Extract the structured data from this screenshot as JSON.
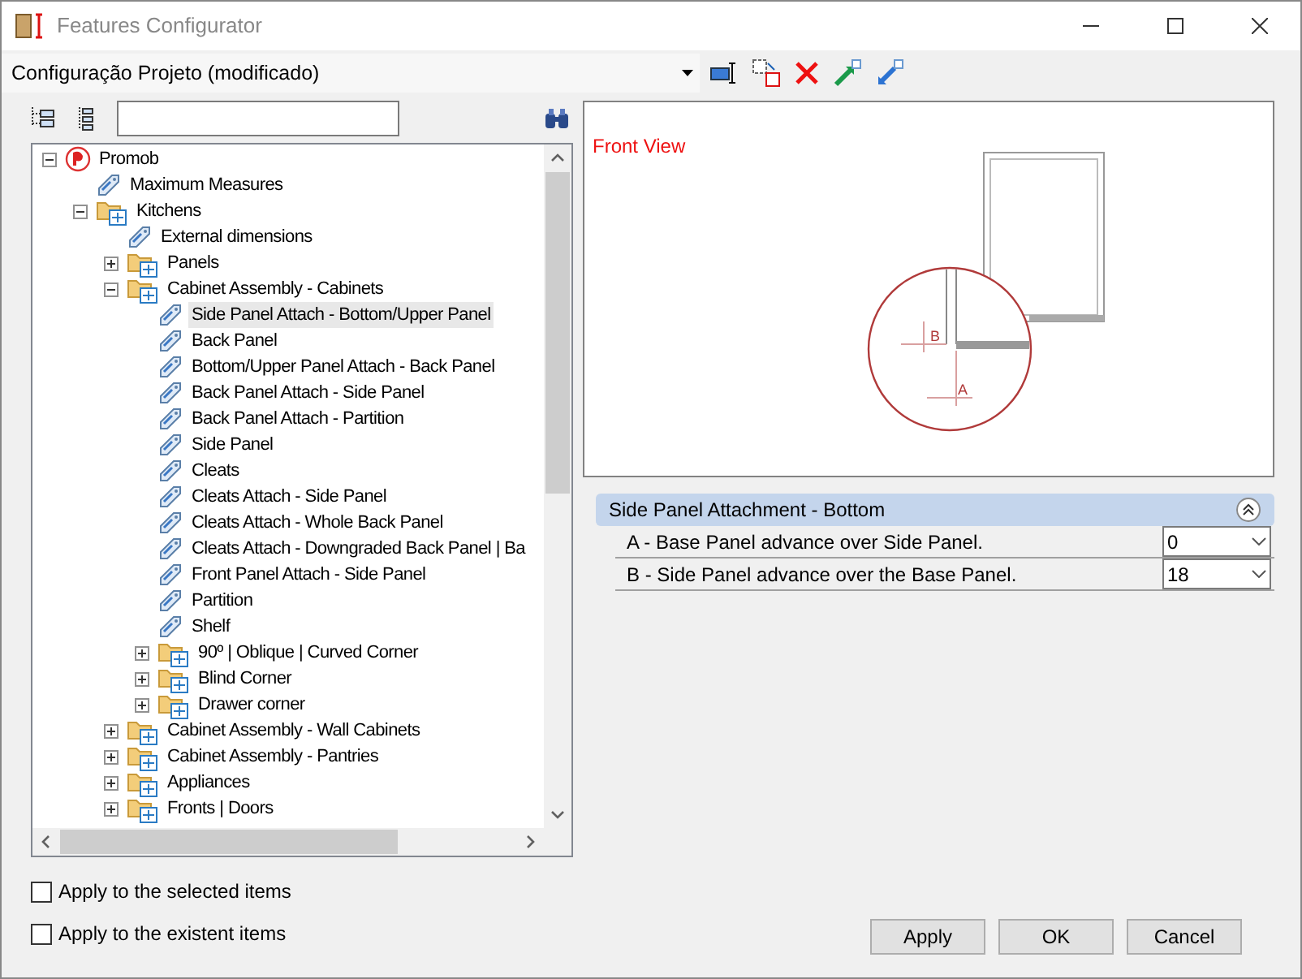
{
  "window": {
    "title": "Features Configurator"
  },
  "configuration": {
    "value": "Configuração Projeto (modificado)"
  },
  "tree": [
    {
      "label": "Promob",
      "kind": "root",
      "expanded": true,
      "selected": false,
      "children": [
        {
          "label": "Maximum Measures",
          "kind": "feature",
          "selected": false
        },
        {
          "label": "Kitchens",
          "kind": "folder",
          "expanded": true,
          "selected": false,
          "children": [
            {
              "label": "External dimensions",
              "kind": "feature",
              "selected": false
            },
            {
              "label": "Panels",
              "kind": "folder",
              "expanded": false,
              "selected": false
            },
            {
              "label": "Cabinet Assembly - Cabinets",
              "kind": "folder",
              "expanded": true,
              "selected": false,
              "children": [
                {
                  "label": "Side Panel Attach - Bottom/Upper Panel",
                  "kind": "feature",
                  "selected": true
                },
                {
                  "label": "Back Panel",
                  "kind": "feature",
                  "selected": false
                },
                {
                  "label": " Bottom/Upper Panel Attach - Back Panel",
                  "kind": "feature",
                  "selected": false
                },
                {
                  "label": "Back Panel Attach - Side Panel",
                  "kind": "feature",
                  "selected": false
                },
                {
                  "label": "Back Panel Attach - Partition",
                  "kind": "feature",
                  "selected": false
                },
                {
                  "label": "Side Panel",
                  "kind": "feature",
                  "selected": false
                },
                {
                  "label": "Cleats",
                  "kind": "feature",
                  "selected": false
                },
                {
                  "label": "Cleats Attach - Side Panel",
                  "kind": "feature",
                  "selected": false
                },
                {
                  "label": "Cleats Attach - Whole Back Panel",
                  "kind": "feature",
                  "selected": false
                },
                {
                  "label": "Cleats Attach - Downgraded Back Panel | Ba",
                  "kind": "feature",
                  "selected": false
                },
                {
                  "label": "Front Panel Attach - Side Panel",
                  "kind": "feature",
                  "selected": false
                },
                {
                  "label": "Partition",
                  "kind": "feature",
                  "selected": false
                },
                {
                  "label": "Shelf",
                  "kind": "feature",
                  "selected": false
                },
                {
                  "label": "90º | Oblique | Curved Corner",
                  "kind": "folder",
                  "expanded": false,
                  "selected": false
                },
                {
                  "label": "Blind Corner",
                  "kind": "folder",
                  "expanded": false,
                  "selected": false
                },
                {
                  "label": "Drawer corner",
                  "kind": "folder",
                  "expanded": false,
                  "selected": false
                }
              ]
            },
            {
              "label": "Cabinet Assembly - Wall Cabinets",
              "kind": "folder",
              "expanded": false,
              "selected": false
            },
            {
              "label": "Cabinet Assembly - Pantries",
              "kind": "folder",
              "expanded": false,
              "selected": false
            },
            {
              "label": "Appliances",
              "kind": "folder",
              "expanded": false,
              "selected": false
            },
            {
              "label": "Fronts | Doors",
              "kind": "folder",
              "expanded": false,
              "selected": false
            }
          ]
        }
      ]
    }
  ],
  "preview": {
    "title": "Front View",
    "dimension_labels": [
      "B",
      "A"
    ]
  },
  "properties": {
    "title": "Side Panel Attachment - Bottom",
    "expanded": true,
    "rows": [
      {
        "label": "A - Base Panel advance over Side Panel.",
        "value": "0"
      },
      {
        "label": "B - Side Panel advance over the Base Panel.",
        "value": "18"
      }
    ]
  },
  "options": [
    {
      "label": "Apply to the selected items",
      "checked": false
    },
    {
      "label": "Apply to the existent items",
      "checked": false
    }
  ],
  "buttons": [
    "Apply",
    "OK",
    "Cancel"
  ]
}
